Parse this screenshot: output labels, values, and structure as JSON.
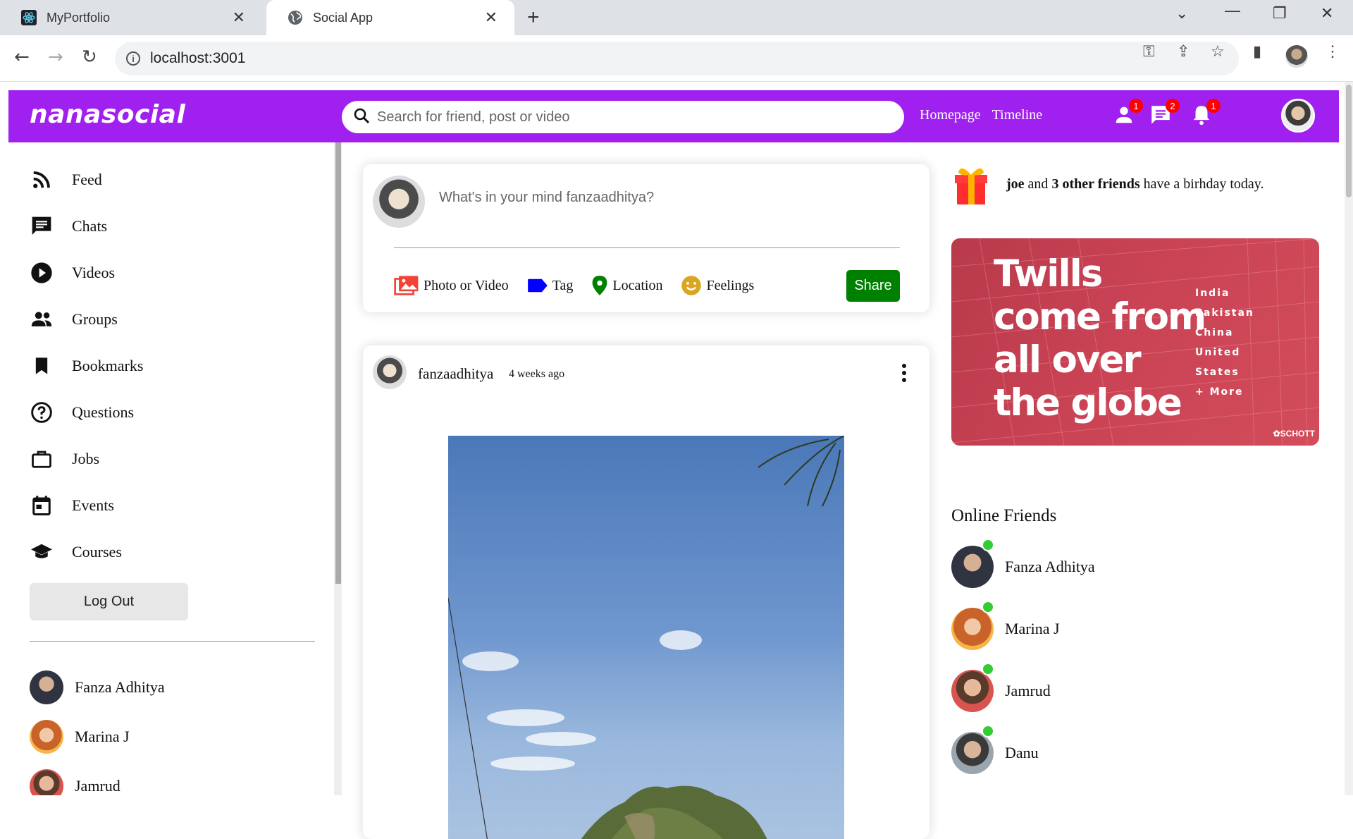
{
  "browser": {
    "tabs": [
      {
        "title": "MyPortfolio",
        "icon": "react-icon",
        "active": false
      },
      {
        "title": "Social App",
        "icon": "globe-icon",
        "active": true
      }
    ],
    "url": "localhost:3001"
  },
  "topbar": {
    "logo": "nanasocial",
    "search_placeholder": "Search for friend, post or video",
    "links": [
      "Homepage",
      "Timeline"
    ],
    "badges": {
      "friend_requests": "1",
      "messages": "2",
      "notifications": "1"
    },
    "bg_color": "#a020f0"
  },
  "sidebar": {
    "menu": [
      {
        "label": "Feed",
        "icon": "rss-icon"
      },
      {
        "label": "Chats",
        "icon": "chat-icon"
      },
      {
        "label": "Videos",
        "icon": "play-circle-icon"
      },
      {
        "label": "Groups",
        "icon": "group-icon"
      },
      {
        "label": "Bookmarks",
        "icon": "bookmark-icon"
      },
      {
        "label": "Questions",
        "icon": "help-circle-icon"
      },
      {
        "label": "Jobs",
        "icon": "briefcase-icon"
      },
      {
        "label": "Events",
        "icon": "calendar-icon"
      },
      {
        "label": "Courses",
        "icon": "graduation-cap-icon"
      }
    ],
    "logout_label": "Log Out",
    "friends": [
      "Fanza Adhitya",
      "Marina J",
      "Jamrud"
    ]
  },
  "share": {
    "placeholder": "What's in your mind fanzaadhitya?",
    "options": [
      {
        "label": "Photo or Video",
        "icon": "photo-icon",
        "color": "#f44336"
      },
      {
        "label": "Tag",
        "icon": "tag-icon",
        "color": "#0000ff"
      },
      {
        "label": "Location",
        "icon": "location-pin-icon",
        "color": "#008000"
      },
      {
        "label": "Feelings",
        "icon": "smile-icon",
        "color": "#daa520"
      }
    ],
    "share_label": "Share"
  },
  "post": {
    "username": "fanzaadhitya",
    "time": "4 weeks ago"
  },
  "rightbar": {
    "birthday": {
      "name": "joe",
      "and": " and ",
      "others": "3 other friends",
      "rest": " have a birhday today."
    },
    "ad": {
      "headline": [
        "Twills",
        "come from",
        "all over",
        "the globe"
      ],
      "countries": [
        "India",
        "Pakistan",
        "China",
        "United",
        "States",
        "+ More"
      ],
      "brand": "SCHOTT"
    },
    "online_title": "Online Friends",
    "online_friends": [
      "Fanza Adhitya",
      "Marina J",
      "Jamrud",
      "Danu"
    ]
  }
}
